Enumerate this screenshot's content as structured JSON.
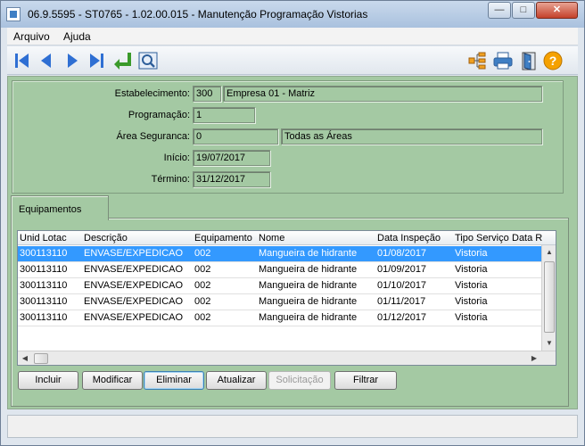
{
  "window": {
    "title": "06.9.5595 - ST0765 - 1.02.00.015 - Manutenção Programação Vistorias"
  },
  "menu": [
    "Arquivo",
    "Ajuda"
  ],
  "toolbar": {
    "nav": [
      "first-record-icon",
      "previous-record-icon",
      "next-record-icon",
      "last-record-icon",
      "return-icon",
      "search-icon"
    ],
    "right": [
      "tree-icon",
      "print-icon",
      "exit-door-icon",
      "help-icon"
    ],
    "colors": {
      "nav_blue": "#2f6fd3",
      "return_green": "#3a9a2a",
      "help_orange": "#f5a100"
    }
  },
  "form": {
    "estabelecimento": {
      "label": "Estabelecimento:",
      "code": "300",
      "desc": "Empresa 01 - Matriz"
    },
    "programacao": {
      "label": "Programação:",
      "value": "1"
    },
    "area": {
      "label": "Área Seguranca:",
      "code": "0",
      "desc": "Todas as Áreas"
    },
    "inicio": {
      "label": "Início:",
      "value": "19/07/2017"
    },
    "termino": {
      "label": "Término:",
      "value": "31/12/2017"
    }
  },
  "tabs": {
    "equipamentos": "Equipamentos"
  },
  "grid": {
    "columns": [
      "Unid Lotac",
      "Descrição",
      "Equipamento",
      "Nome",
      "Data Inspeção",
      "Tipo Serviço",
      "Data R"
    ],
    "rows": [
      [
        "300113110",
        "ENVASE/EXPEDICAO",
        "002",
        "Mangueira de hidrante",
        "01/08/2017",
        "Vistoria"
      ],
      [
        "300113110",
        "ENVASE/EXPEDICAO",
        "002",
        "Mangueira de hidrante",
        "01/09/2017",
        "Vistoria"
      ],
      [
        "300113110",
        "ENVASE/EXPEDICAO",
        "002",
        "Mangueira de hidrante",
        "01/10/2017",
        "Vistoria"
      ],
      [
        "300113110",
        "ENVASE/EXPEDICAO",
        "002",
        "Mangueira de hidrante",
        "01/11/2017",
        "Vistoria"
      ],
      [
        "300113110",
        "ENVASE/EXPEDICAO",
        "002",
        "Mangueira de hidrante",
        "01/12/2017",
        "Vistoria"
      ]
    ],
    "selected_row": 0
  },
  "buttons": {
    "incluir": "Incluir",
    "modificar": "Modificar",
    "eliminar": "Eliminar",
    "atualizar": "Atualizar",
    "solicitacao": "Solicitação",
    "filtrar": "Filtrar"
  },
  "colors": {
    "panel_bg": "#a4c9a3",
    "selection": "#3399ff"
  }
}
